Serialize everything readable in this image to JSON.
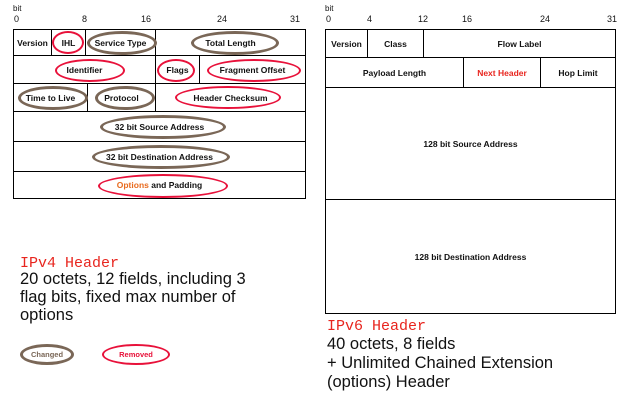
{
  "ipv4": {
    "bit_label": "bit",
    "ticks": [
      "0",
      "8",
      "16",
      "24",
      "31"
    ],
    "fields": {
      "version": "Version",
      "ihl": "IHL",
      "service_type": "Service Type",
      "total_length": "Total Length",
      "identifier": "Identifier",
      "flags": "Flags",
      "fragment_offset": "Fragment Offset",
      "ttl": "Time to Live",
      "protocol": "Protocol",
      "header_checksum": "Header Checksum",
      "src": "32 bit Source Address",
      "dst": "32 bit Destination Address",
      "options_word": "Options",
      "padding_rest": " and Padding"
    },
    "caption_title": "IPv4 Header",
    "caption_lines": [
      "20 octets, 12 fields, including 3",
      "flag bits, fixed max number of",
      "options"
    ]
  },
  "legend": {
    "changed": "Changed",
    "removed": "Removed",
    "changed_color": "#7a6757",
    "removed_color": "#e8113a"
  },
  "ipv6": {
    "bit_label": "bit",
    "ticks": [
      "0",
      "4",
      "12",
      "16",
      "24",
      "31"
    ],
    "fields": {
      "version": "Version",
      "class": "Class",
      "flow_label": "Flow Label",
      "payload_length": "Payload Length",
      "next_header": "Next Header",
      "hop_limit": "Hop Limit",
      "src": "128 bit Source Address",
      "dst": "128 bit Destination Address"
    },
    "caption_title": "IPv6 Header",
    "caption_lines": [
      "40 octets, 8 fields",
      "+ Unlimited Chained Extension",
      "(options) Header"
    ]
  }
}
